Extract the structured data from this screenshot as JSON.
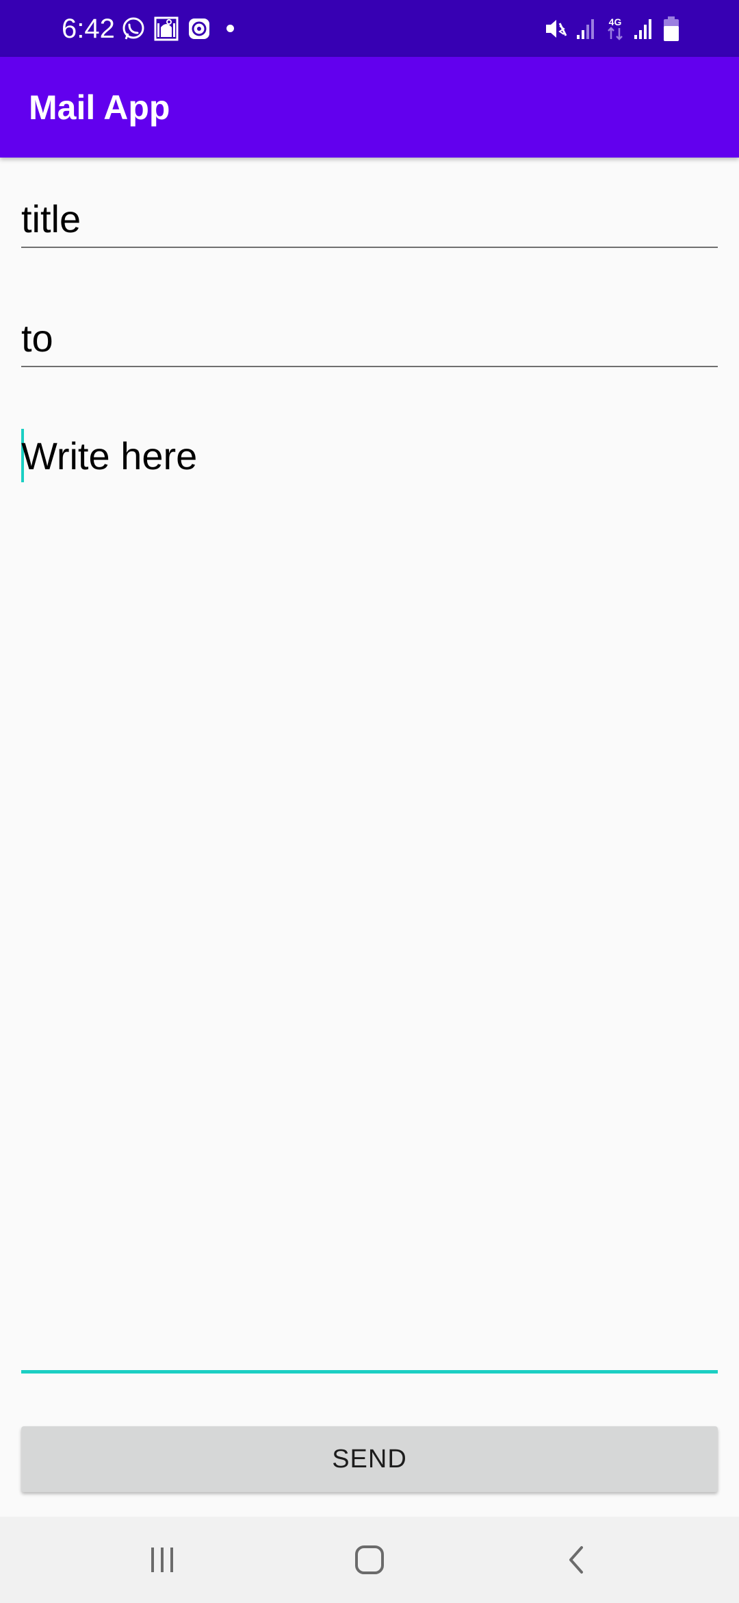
{
  "status_bar": {
    "time": "6:42",
    "left_icons": [
      "whatsapp-icon",
      "mosque-icon",
      "app-icon"
    ],
    "right_icons": [
      "vibrate-icon",
      "signal-icon",
      "network-4g-icon",
      "signal-icon",
      "battery-icon"
    ],
    "network_label": "4G"
  },
  "app_bar": {
    "title": "Mail App"
  },
  "form": {
    "title_field": "title",
    "to_field": "to",
    "body_field": "Write here"
  },
  "send_button": {
    "label": "SEND"
  },
  "nav_bar": {
    "icons": [
      "recents-icon",
      "home-icon",
      "back-icon"
    ]
  },
  "colors": {
    "status_bar": "#3700b3",
    "app_bar": "#6200ee",
    "accent": "#1bcfc3",
    "background": "#fafafa",
    "button": "#d6d7d7"
  }
}
